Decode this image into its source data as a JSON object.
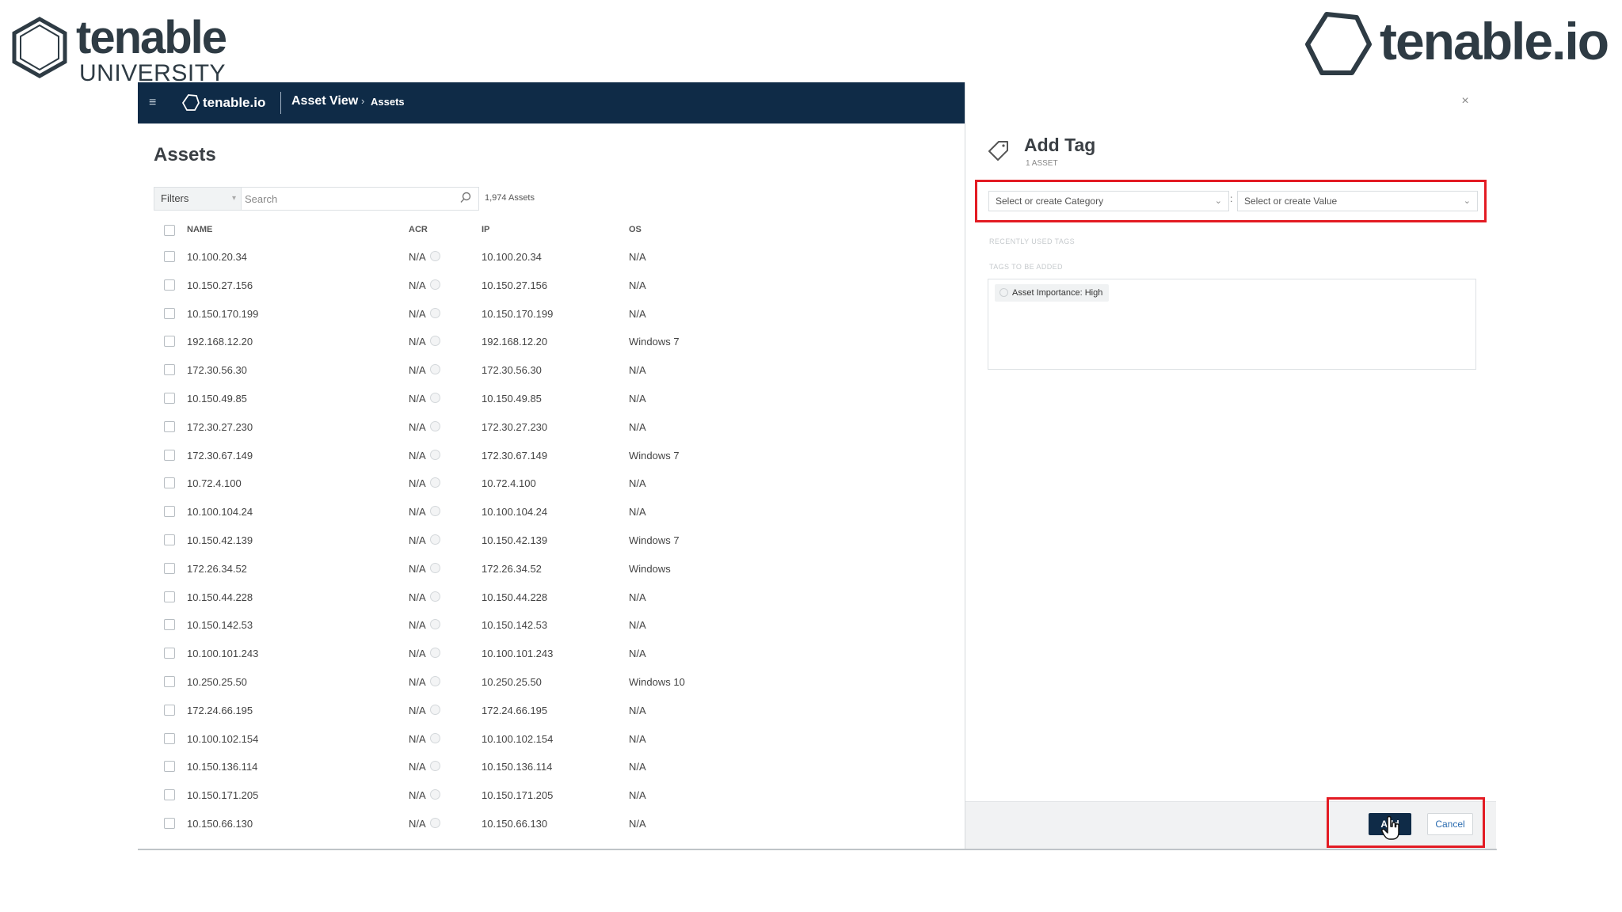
{
  "branding": {
    "left_wordmark": "tenable",
    "left_subtitle": "UNIVERSITY",
    "right_wordmark": "tenable.io"
  },
  "header": {
    "app_logo": "tenable.io",
    "breadcrumb_main": "Asset View",
    "breadcrumb_separator": "›",
    "breadcrumb_sub": "Assets",
    "menu_icon": "hamburger-icon"
  },
  "assets": {
    "title": "Assets",
    "filters_label": "Filters",
    "search_placeholder": "Search",
    "count": "1,974 Assets",
    "columns": {
      "name": "NAME",
      "acr": "ACR",
      "ip": "IP",
      "os": "OS"
    },
    "rows": [
      {
        "name": "10.100.20.34",
        "acr": "N/A",
        "ip": "10.100.20.34",
        "os": "N/A"
      },
      {
        "name": "10.150.27.156",
        "acr": "N/A",
        "ip": "10.150.27.156",
        "os": "N/A"
      },
      {
        "name": "10.150.170.199",
        "acr": "N/A",
        "ip": "10.150.170.199",
        "os": "N/A"
      },
      {
        "name": "192.168.12.20",
        "acr": "N/A",
        "ip": "192.168.12.20",
        "os": "Windows 7"
      },
      {
        "name": "172.30.56.30",
        "acr": "N/A",
        "ip": "172.30.56.30",
        "os": "N/A"
      },
      {
        "name": "10.150.49.85",
        "acr": "N/A",
        "ip": "10.150.49.85",
        "os": "N/A"
      },
      {
        "name": "172.30.27.230",
        "acr": "N/A",
        "ip": "172.30.27.230",
        "os": "N/A"
      },
      {
        "name": "172.30.67.149",
        "acr": "N/A",
        "ip": "172.30.67.149",
        "os": "Windows 7"
      },
      {
        "name": "10.72.4.100",
        "acr": "N/A",
        "ip": "10.72.4.100",
        "os": "N/A"
      },
      {
        "name": "10.100.104.24",
        "acr": "N/A",
        "ip": "10.100.104.24",
        "os": "N/A"
      },
      {
        "name": "10.150.42.139",
        "acr": "N/A",
        "ip": "10.150.42.139",
        "os": "Windows 7"
      },
      {
        "name": "172.26.34.52",
        "acr": "N/A",
        "ip": "172.26.34.52",
        "os": "Windows"
      },
      {
        "name": "10.150.44.228",
        "acr": "N/A",
        "ip": "10.150.44.228",
        "os": "N/A"
      },
      {
        "name": "10.150.142.53",
        "acr": "N/A",
        "ip": "10.150.142.53",
        "os": "N/A"
      },
      {
        "name": "10.100.101.243",
        "acr": "N/A",
        "ip": "10.100.101.243",
        "os": "N/A"
      },
      {
        "name": "10.250.25.50",
        "acr": "N/A",
        "ip": "10.250.25.50",
        "os": "Windows 10"
      },
      {
        "name": "172.24.66.195",
        "acr": "N/A",
        "ip": "172.24.66.195",
        "os": "N/A"
      },
      {
        "name": "10.100.102.154",
        "acr": "N/A",
        "ip": "10.100.102.154",
        "os": "N/A"
      },
      {
        "name": "10.150.136.114",
        "acr": "N/A",
        "ip": "10.150.136.114",
        "os": "N/A"
      },
      {
        "name": "10.150.171.205",
        "acr": "N/A",
        "ip": "10.150.171.205",
        "os": "N/A"
      },
      {
        "name": "10.150.66.130",
        "acr": "N/A",
        "ip": "10.150.66.130",
        "os": "N/A"
      }
    ]
  },
  "add_tag": {
    "title": "Add Tag",
    "subtitle": "1 ASSET",
    "category_placeholder": "Select or create Category",
    "value_placeholder": "Select or create Value",
    "separator": ":",
    "recently_used_label": "RECENTLY USED TAGS",
    "tags_to_add_label": "TAGS TO BE ADDED",
    "tags": [
      {
        "label": "Asset Importance: High"
      }
    ],
    "add_button": "Add",
    "cancel_button": "Cancel",
    "close_glyph": "×"
  },
  "colors": {
    "header_bg": "#0f2b47",
    "highlight": "#e31b23",
    "link": "#2b6cb0"
  }
}
